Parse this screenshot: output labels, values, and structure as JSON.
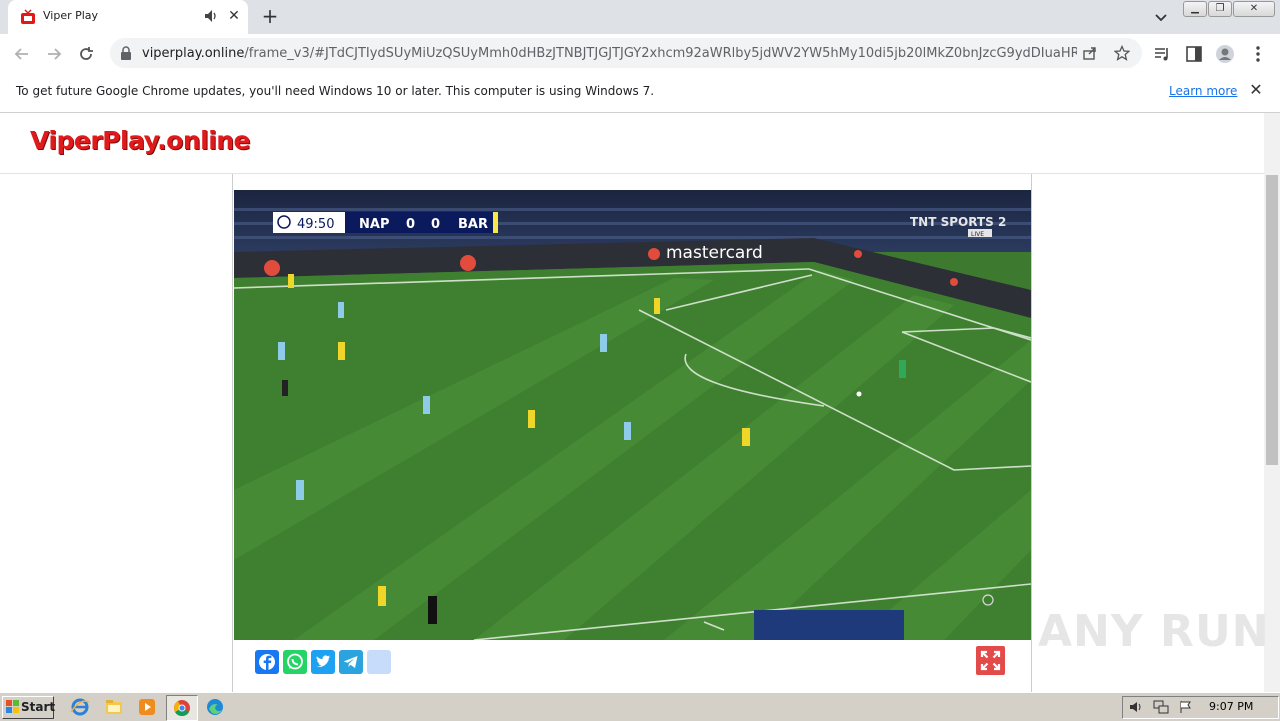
{
  "browser": {
    "tab_title": "Viper Play",
    "url_host": "viperplay.online",
    "url_path": "/frame_v3/#JTdCJTIydSUyMiUzQSUyMmh0dHBzJTNBJTJGJTJGY2xhcm92aWRlby5jdWV2YW5hMy10di5jb20lMkZ0bnJzcG9ydDIuaHR..."
  },
  "infobar": {
    "message": "To get future Google Chrome updates, you'll need Windows 10 or later. This computer is using Windows 7.",
    "learn_more": "Learn more"
  },
  "site": {
    "logo_text": "ViperPlay.online"
  },
  "video": {
    "clock": "49:50",
    "home_team": "NAP",
    "home_score": "0",
    "away_score": "0",
    "away_team": "BAR",
    "broadcaster": "TNT SPORTS 2",
    "live_badge": "LIVE",
    "ad_board": "mastercard"
  },
  "share_buttons": [
    "facebook-icon",
    "whatsapp-icon",
    "twitter-icon",
    "telegram-icon",
    "share-icon"
  ],
  "taskbar": {
    "start_label": "Start",
    "clock": "9:07 PM"
  },
  "watermark": "ANY RUN",
  "colors": {
    "logo_red": "#e0191b",
    "fullscreen_red": "#e34a4a",
    "pitch_green": "#3d7a30",
    "facebook": "#1877f2",
    "whatsapp": "#25d366",
    "twitter": "#1da1f2",
    "telegram": "#2aa3df"
  }
}
